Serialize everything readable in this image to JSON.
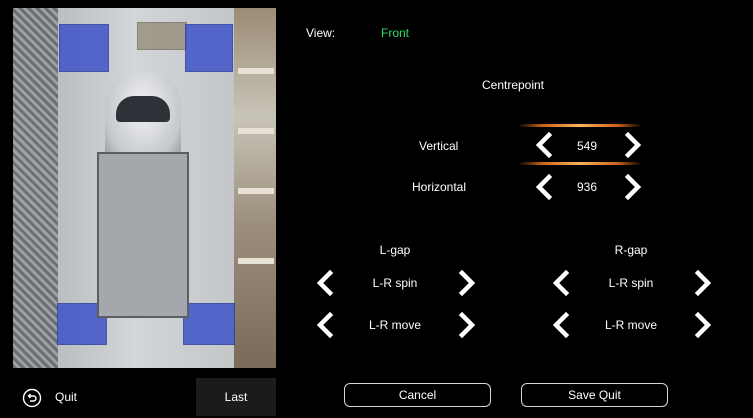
{
  "view": {
    "label": "View:",
    "value": "Front"
  },
  "centrepoint": {
    "title": "Centrepoint",
    "vertical": {
      "label": "Vertical",
      "value": "549"
    },
    "horizontal": {
      "label": "Horizontal",
      "value": "936"
    }
  },
  "left_gap": {
    "title": "L-gap",
    "spin_label": "L-R spin",
    "move_label": "L-R move"
  },
  "right_gap": {
    "title": "R-gap",
    "spin_label": "L-R spin",
    "move_label": "L-R move"
  },
  "bottom": {
    "quit_label": "Quit",
    "last_label": "Last",
    "cancel_label": "Cancel",
    "save_quit_label": "Save Quit"
  },
  "colors": {
    "accent_green": "#2ee06b",
    "glow_orange": "#ffb060"
  }
}
